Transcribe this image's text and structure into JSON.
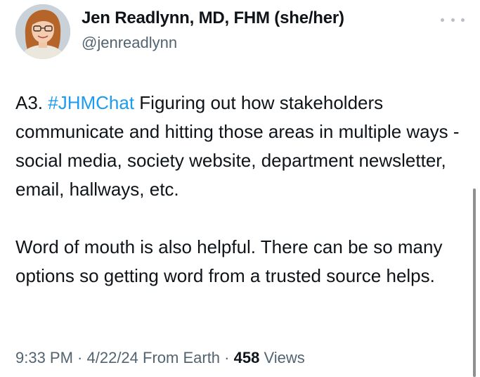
{
  "author": {
    "name": "Jen Readlynn, MD, FHM (she/her)",
    "handle": "@jenreadlynn"
  },
  "tweet": {
    "prefix": "A3. ",
    "hashtag": "#JHMChat",
    "line1_rest": " Figuring out how stakeholders communicate and hitting those areas in multiple ways - social media, society website, department newsletter, email, hallways, etc.",
    "paragraph2": "Word of mouth is also helpful. There can be so many options so getting word from a trusted source helps."
  },
  "meta": {
    "time": "9:33 PM",
    "sep1": " · ",
    "date": "4/22/24",
    "source": " From Earth",
    "sep2": " · ",
    "views_count": "458",
    "views_label": " Views"
  },
  "icons": {
    "more": "more-dots-icon",
    "avatar": "profile-photo"
  },
  "colors": {
    "hashtag": "#1d9bf0",
    "secondary_text": "#536471",
    "primary_text": "#0f1419"
  }
}
